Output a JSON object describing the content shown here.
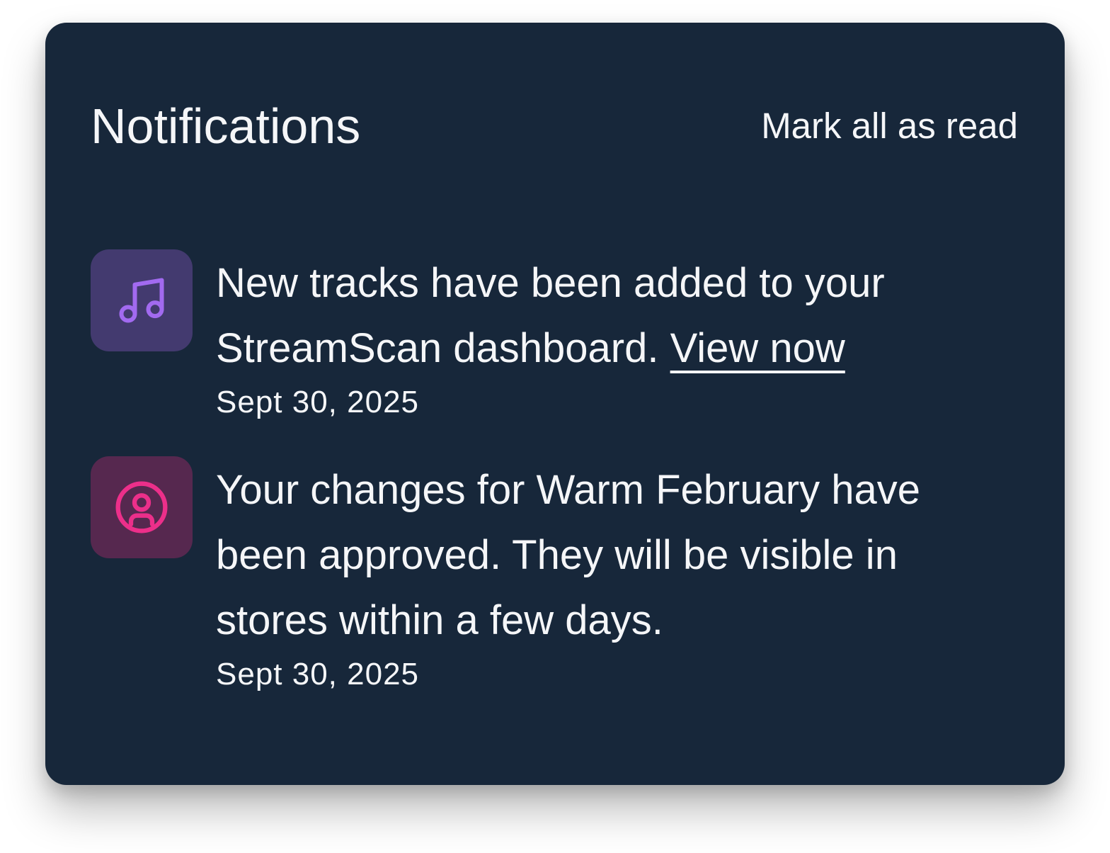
{
  "header": {
    "title": "Notifications",
    "mark_all_label": "Mark all as read"
  },
  "notifications": [
    {
      "icon": "music-note-icon",
      "accent": "#a26af0",
      "icon_bg": "#433a6f",
      "message": "New tracks have been added to your StreamScan dashboard.",
      "link_label": "View now",
      "date": "Sept 30, 2025"
    },
    {
      "icon": "user-circle-icon",
      "accent": "#ec2f8a",
      "icon_bg": "#56284f",
      "message": "Your changes for Warm February have been approved. They will be visible in stores within a few days.",
      "date": "Sept 30, 2025"
    }
  ],
  "colors": {
    "panel_bg": "#17273a",
    "text": "#f5f6f8"
  }
}
